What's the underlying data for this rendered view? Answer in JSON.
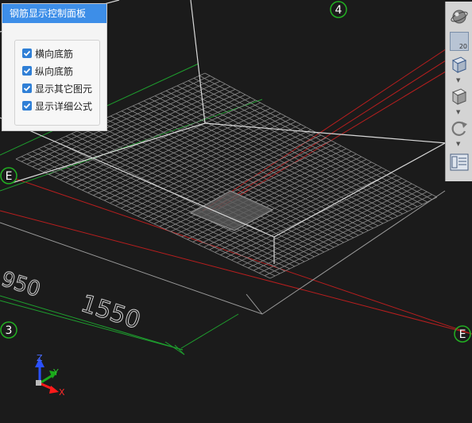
{
  "panel": {
    "title": "钢筋显示控制面板",
    "options": [
      {
        "label": "横向底筋",
        "checked": true
      },
      {
        "label": "纵向底筋",
        "checked": true
      },
      {
        "label": "显示其它图元",
        "checked": true
      },
      {
        "label": "显示详细公式",
        "checked": true
      }
    ]
  },
  "viewport": {
    "axis_labels": {
      "top": "4",
      "left_e": "E",
      "left_3": "3",
      "right_e": "E"
    },
    "dimensions": {
      "dim_left": "950",
      "dim_bottom": "1550"
    },
    "triad": {
      "x": "X",
      "y": "Y",
      "z": "Z"
    },
    "colors": {
      "background": "#1b1b1b",
      "grid": "#8a8a8a",
      "axis_red": "#c02020",
      "axis_green": "#1e9e2e",
      "bubble": "#22b022"
    }
  },
  "toolbar": {
    "buttons": [
      "orbit-icon",
      "zoom-level-icon",
      "view-cube-icon",
      "box-view-icon",
      "rotate-icon",
      "layers-icon"
    ],
    "zoom_label": "20"
  }
}
